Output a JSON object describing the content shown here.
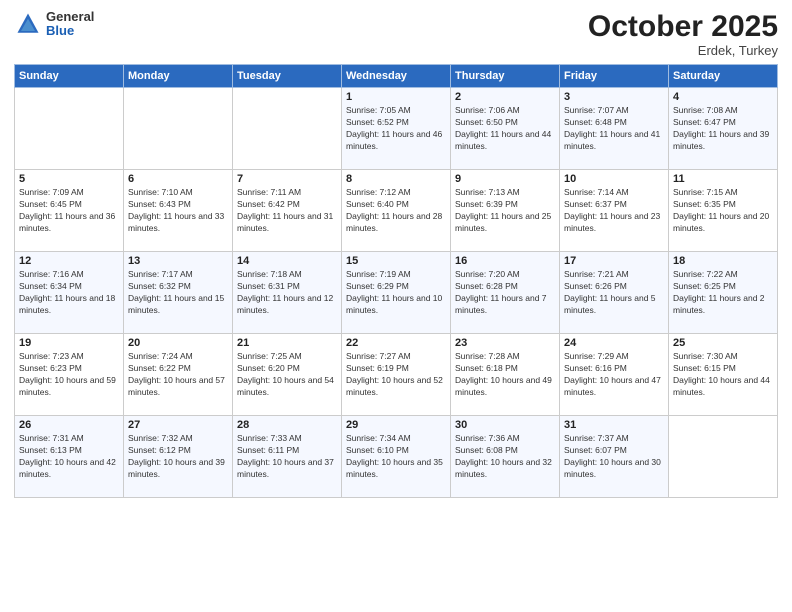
{
  "header": {
    "logo": {
      "general": "General",
      "blue": "Blue"
    },
    "title": "October 2025",
    "subtitle": "Erdek, Turkey"
  },
  "days_of_week": [
    "Sunday",
    "Monday",
    "Tuesday",
    "Wednesday",
    "Thursday",
    "Friday",
    "Saturday"
  ],
  "weeks": [
    [
      null,
      null,
      null,
      {
        "day": 1,
        "sunrise": "7:05 AM",
        "sunset": "6:52 PM",
        "daylight": "11 hours and 46 minutes."
      },
      {
        "day": 2,
        "sunrise": "7:06 AM",
        "sunset": "6:50 PM",
        "daylight": "11 hours and 44 minutes."
      },
      {
        "day": 3,
        "sunrise": "7:07 AM",
        "sunset": "6:48 PM",
        "daylight": "11 hours and 41 minutes."
      },
      {
        "day": 4,
        "sunrise": "7:08 AM",
        "sunset": "6:47 PM",
        "daylight": "11 hours and 39 minutes."
      }
    ],
    [
      {
        "day": 5,
        "sunrise": "7:09 AM",
        "sunset": "6:45 PM",
        "daylight": "11 hours and 36 minutes."
      },
      {
        "day": 6,
        "sunrise": "7:10 AM",
        "sunset": "6:43 PM",
        "daylight": "11 hours and 33 minutes."
      },
      {
        "day": 7,
        "sunrise": "7:11 AM",
        "sunset": "6:42 PM",
        "daylight": "11 hours and 31 minutes."
      },
      {
        "day": 8,
        "sunrise": "7:12 AM",
        "sunset": "6:40 PM",
        "daylight": "11 hours and 28 minutes."
      },
      {
        "day": 9,
        "sunrise": "7:13 AM",
        "sunset": "6:39 PM",
        "daylight": "11 hours and 25 minutes."
      },
      {
        "day": 10,
        "sunrise": "7:14 AM",
        "sunset": "6:37 PM",
        "daylight": "11 hours and 23 minutes."
      },
      {
        "day": 11,
        "sunrise": "7:15 AM",
        "sunset": "6:35 PM",
        "daylight": "11 hours and 20 minutes."
      }
    ],
    [
      {
        "day": 12,
        "sunrise": "7:16 AM",
        "sunset": "6:34 PM",
        "daylight": "11 hours and 18 minutes."
      },
      {
        "day": 13,
        "sunrise": "7:17 AM",
        "sunset": "6:32 PM",
        "daylight": "11 hours and 15 minutes."
      },
      {
        "day": 14,
        "sunrise": "7:18 AM",
        "sunset": "6:31 PM",
        "daylight": "11 hours and 12 minutes."
      },
      {
        "day": 15,
        "sunrise": "7:19 AM",
        "sunset": "6:29 PM",
        "daylight": "11 hours and 10 minutes."
      },
      {
        "day": 16,
        "sunrise": "7:20 AM",
        "sunset": "6:28 PM",
        "daylight": "11 hours and 7 minutes."
      },
      {
        "day": 17,
        "sunrise": "7:21 AM",
        "sunset": "6:26 PM",
        "daylight": "11 hours and 5 minutes."
      },
      {
        "day": 18,
        "sunrise": "7:22 AM",
        "sunset": "6:25 PM",
        "daylight": "11 hours and 2 minutes."
      }
    ],
    [
      {
        "day": 19,
        "sunrise": "7:23 AM",
        "sunset": "6:23 PM",
        "daylight": "10 hours and 59 minutes."
      },
      {
        "day": 20,
        "sunrise": "7:24 AM",
        "sunset": "6:22 PM",
        "daylight": "10 hours and 57 minutes."
      },
      {
        "day": 21,
        "sunrise": "7:25 AM",
        "sunset": "6:20 PM",
        "daylight": "10 hours and 54 minutes."
      },
      {
        "day": 22,
        "sunrise": "7:27 AM",
        "sunset": "6:19 PM",
        "daylight": "10 hours and 52 minutes."
      },
      {
        "day": 23,
        "sunrise": "7:28 AM",
        "sunset": "6:18 PM",
        "daylight": "10 hours and 49 minutes."
      },
      {
        "day": 24,
        "sunrise": "7:29 AM",
        "sunset": "6:16 PM",
        "daylight": "10 hours and 47 minutes."
      },
      {
        "day": 25,
        "sunrise": "7:30 AM",
        "sunset": "6:15 PM",
        "daylight": "10 hours and 44 minutes."
      }
    ],
    [
      {
        "day": 26,
        "sunrise": "7:31 AM",
        "sunset": "6:13 PM",
        "daylight": "10 hours and 42 minutes."
      },
      {
        "day": 27,
        "sunrise": "7:32 AM",
        "sunset": "6:12 PM",
        "daylight": "10 hours and 39 minutes."
      },
      {
        "day": 28,
        "sunrise": "7:33 AM",
        "sunset": "6:11 PM",
        "daylight": "10 hours and 37 minutes."
      },
      {
        "day": 29,
        "sunrise": "7:34 AM",
        "sunset": "6:10 PM",
        "daylight": "10 hours and 35 minutes."
      },
      {
        "day": 30,
        "sunrise": "7:36 AM",
        "sunset": "6:08 PM",
        "daylight": "10 hours and 32 minutes."
      },
      {
        "day": 31,
        "sunrise": "7:37 AM",
        "sunset": "6:07 PM",
        "daylight": "10 hours and 30 minutes."
      },
      null
    ]
  ]
}
